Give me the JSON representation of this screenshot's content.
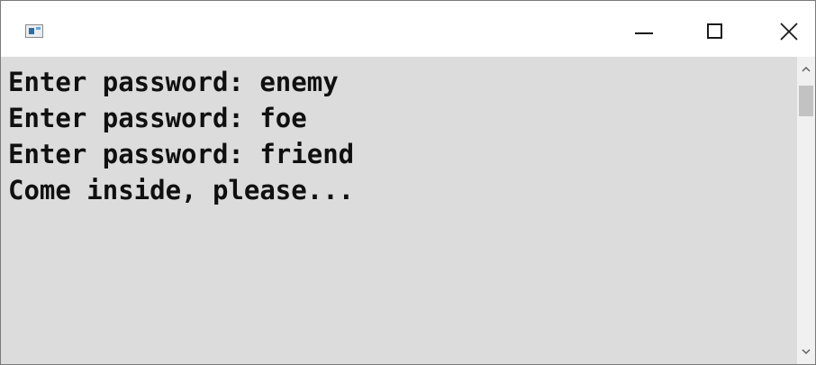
{
  "window": {
    "title": "",
    "icon": "console-app-icon",
    "controls": {
      "minimize": "minimize-icon",
      "maximize": "maximize-icon",
      "close": "close-icon"
    }
  },
  "console": {
    "background": "#dcdcdc",
    "text_color": "#101010",
    "lines": [
      "Enter password: enemy",
      "Enter password: foe",
      "Enter password: friend",
      "Come inside, please..."
    ]
  },
  "scrollbar": {
    "up_icon": "chevron-up-icon",
    "down_icon": "chevron-down-icon"
  }
}
